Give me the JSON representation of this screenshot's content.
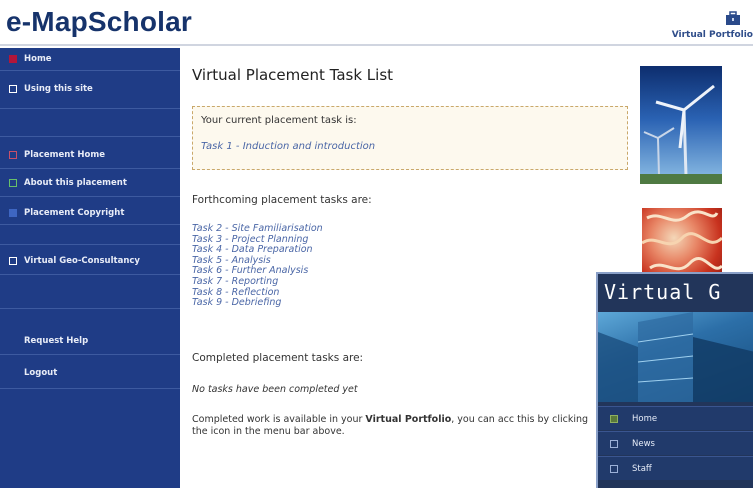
{
  "header": {
    "logo_text": "e-MapScholar",
    "portfolio_link": "Virtual Portfolio",
    "portfolio_icon": "briefcase-icon"
  },
  "sidebar": {
    "items": [
      {
        "label": "Home",
        "bullet": "red-fill"
      },
      {
        "label": "Using this site",
        "bullet": "box"
      },
      {
        "label": "Placement Home",
        "bullet": "red-box"
      },
      {
        "label": "About this placement",
        "bullet": "green-box"
      },
      {
        "label": "Placement Copyright",
        "bullet": "blue-fill"
      },
      {
        "label": "Virtual Geo-Consultancy",
        "bullet": "box"
      },
      {
        "label": "Request Help",
        "bullet": "none"
      },
      {
        "label": "Logout",
        "bullet": "none"
      }
    ]
  },
  "main": {
    "title": "Virtual Placement Task List",
    "current_intro": "Your current placement task is:",
    "current_task": "Task 1 - Induction and introduction",
    "forthcoming_heading": "Forthcoming placement tasks are:",
    "forthcoming_tasks": [
      "Task 2 - Site Familiarisation",
      "Task 3 - Project Planning",
      "Task 4 - Data Preparation",
      "Task 5 - Analysis",
      "Task 6 - Further Analysis",
      "Task 7 - Reporting",
      "Task 8 - Reflection",
      "Task 9 - Debriefing"
    ],
    "completed_heading": "Completed placement tasks are:",
    "no_tasks": "No tasks have been completed yet",
    "portfolio_note_before": "Completed work is available in your ",
    "portfolio_note_bold": "Virtual Portfolio",
    "portfolio_note_after": ", you can acc this by clicking the icon in the menu bar above."
  },
  "overlay": {
    "title": "Virtual G",
    "items": [
      {
        "label": "Home"
      },
      {
        "label": "News"
      },
      {
        "label": "Staff"
      }
    ]
  },
  "colors": {
    "sidebar_bg": "#1f3c86",
    "logo": "#16336b",
    "task_link": "#4a66a6",
    "box_border": "#c9a86a"
  }
}
